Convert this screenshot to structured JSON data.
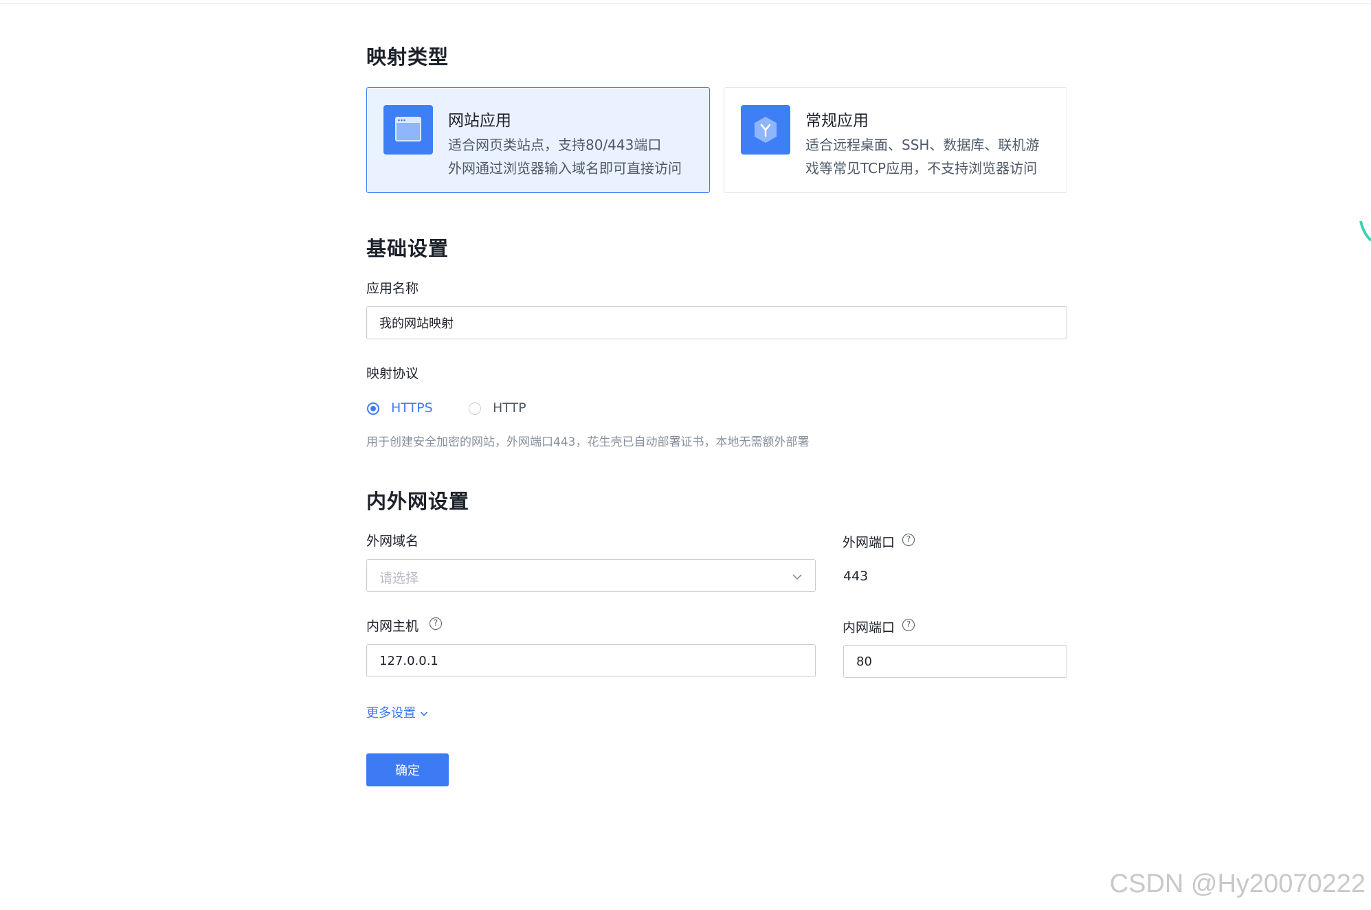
{
  "sections": {
    "mapping_type": "映射类型",
    "basic_settings": "基础设置",
    "network_settings": "内外网设置"
  },
  "mapping_types": [
    {
      "title": "网站应用",
      "desc_line1": "适合网页类站点，支持80/443端口",
      "desc_line2": "外网通过浏览器输入域名即可直接访问",
      "icon": "browser-window-icon",
      "selected": true
    },
    {
      "title": "常规应用",
      "desc_line1": "适合远程桌面、SSH、数据库、联机游",
      "desc_line2": "戏等常见TCP应用，不支持浏览器访问",
      "icon": "cube-icon",
      "selected": false
    }
  ],
  "app_name": {
    "label": "应用名称",
    "value": "我的网站映射"
  },
  "protocol": {
    "label": "映射协议",
    "options": [
      "HTTPS",
      "HTTP"
    ],
    "selected": "HTTPS",
    "hint": "用于创建安全加密的网站，外网端口443，花生壳已自动部署证书，本地无需额外部署"
  },
  "external_domain": {
    "label": "外网域名",
    "placeholder": "请选择"
  },
  "external_port": {
    "label": "外网端口",
    "value": "443"
  },
  "internal_host": {
    "label": "内网主机",
    "value": "127.0.0.1"
  },
  "internal_port": {
    "label": "内网端口",
    "value": "80"
  },
  "more_settings": "更多设置",
  "confirm_button": "确定",
  "watermark": "CSDN @Hy20070222",
  "colors": {
    "primary": "#3d7bf5",
    "selected_card_bg": "#eaf2ff",
    "icon_bg": "#3e7ff5"
  }
}
